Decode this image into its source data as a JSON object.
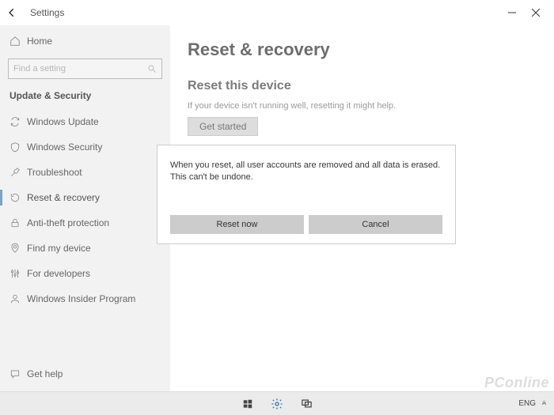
{
  "window": {
    "title": "Settings"
  },
  "sidebar": {
    "home_label": "Home",
    "search_placeholder": "Find a setting",
    "section_label": "Update & Security",
    "items": [
      {
        "label": "Windows Update"
      },
      {
        "label": "Windows Security"
      },
      {
        "label": "Troubleshoot"
      },
      {
        "label": "Reset & recovery"
      },
      {
        "label": "Anti-theft protection"
      },
      {
        "label": "Find my device"
      },
      {
        "label": "For developers"
      },
      {
        "label": "Windows Insider Program"
      }
    ],
    "help_label": "Get help"
  },
  "content": {
    "page_title": "Reset & recovery",
    "section_title": "Reset this device",
    "description": "If your device isn't running well, resetting it might help.",
    "get_started_label": "Get started"
  },
  "dialog": {
    "message": "When you reset, all user accounts are removed and all data is erased. This can't be undone.",
    "reset_label": "Reset now",
    "cancel_label": "Cancel"
  },
  "taskbar": {
    "lang": "ENG"
  },
  "watermark": "PConline"
}
